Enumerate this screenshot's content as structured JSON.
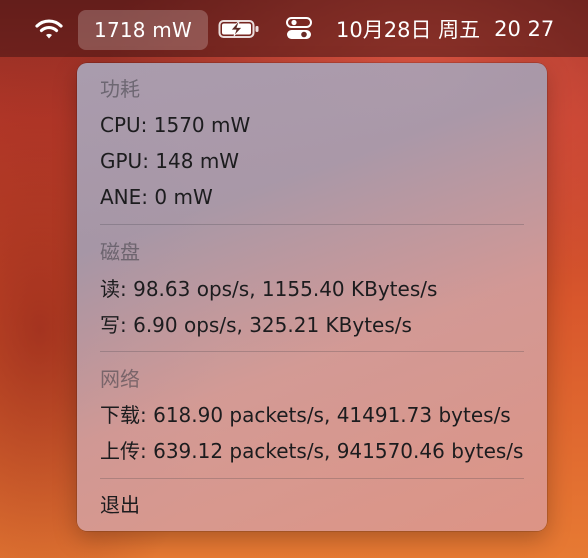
{
  "menubar": {
    "wifi_icon": "wifi-icon",
    "power_label": "1718 mW",
    "battery_icon": "battery-charging-icon",
    "control_icon": "control-center-icon",
    "date": "10月28日 周五",
    "time": "20 27"
  },
  "menu": {
    "power": {
      "title": "功耗",
      "cpu": "CPU: 1570 mW",
      "gpu": "GPU: 148 mW",
      "ane": "ANE: 0 mW"
    },
    "disk": {
      "title": "磁盘",
      "read": "读: 98.63 ops/s, 1155.40 KBytes/s",
      "write": "写: 6.90 ops/s, 325.21 KBytes/s"
    },
    "network": {
      "title": "网络",
      "download": "下载: 618.90 packets/s, 41491.73 bytes/s",
      "upload": "上传: 639.12 packets/s, 941570.46 bytes/s"
    },
    "quit": "退出"
  }
}
